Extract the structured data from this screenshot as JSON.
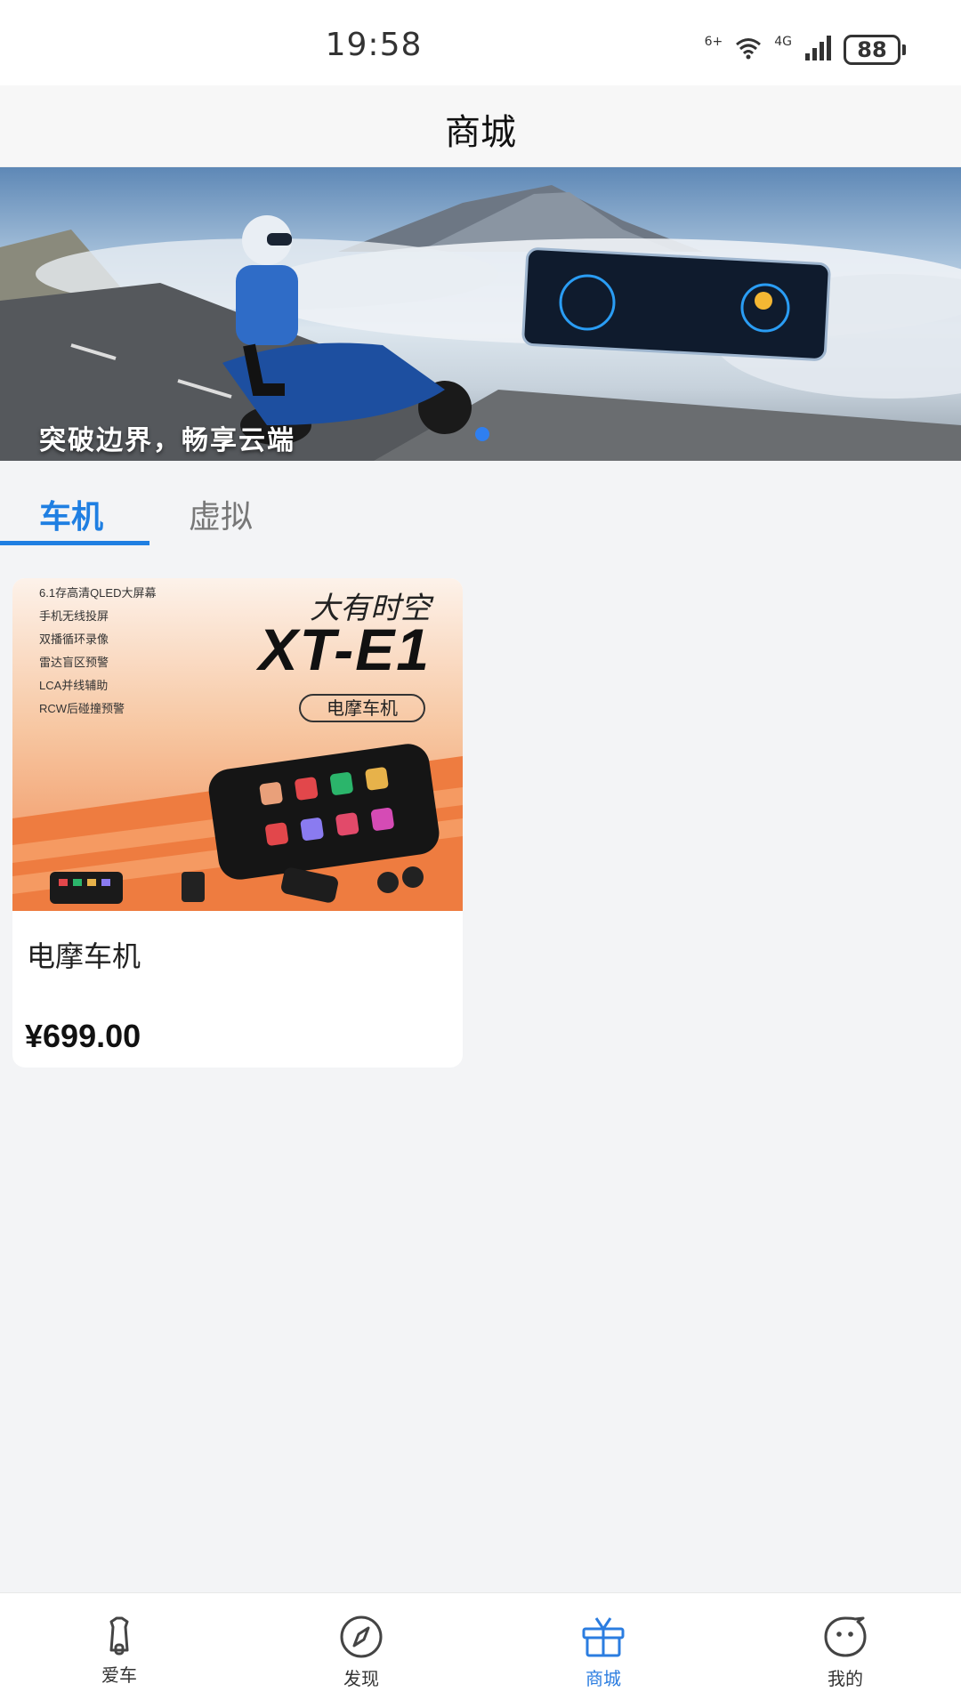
{
  "status_bar": {
    "time": "19:58",
    "wifi_label": "6+",
    "cell_label": "4G",
    "battery": "88"
  },
  "header": {
    "title": "商城"
  },
  "banner": {
    "caption": "突破边界，畅享云端"
  },
  "tabs": [
    {
      "label": "车机",
      "active": true
    },
    {
      "label": "虚拟",
      "active": false
    }
  ],
  "products": [
    {
      "features": [
        "6.1存高清QLED大屏幕",
        "手机无线投屏",
        "双播循环录像",
        "雷达盲区预警",
        "LCA并线辅助",
        "RCW后碰撞预警"
      ],
      "brand": "大有时空",
      "model": "XT-E1",
      "tag": "电摩车机",
      "name": "电摩车机",
      "price": "¥699.00"
    }
  ],
  "bottom_nav": [
    {
      "label": "爱车",
      "icon": "scooter-icon",
      "active": false
    },
    {
      "label": "发现",
      "icon": "compass-icon",
      "active": false
    },
    {
      "label": "商城",
      "icon": "gift-icon",
      "active": true
    },
    {
      "label": "我的",
      "icon": "chat-face-icon",
      "active": false
    }
  ],
  "colors": {
    "accent": "#1f7fe2",
    "background": "#f3f4f6"
  }
}
